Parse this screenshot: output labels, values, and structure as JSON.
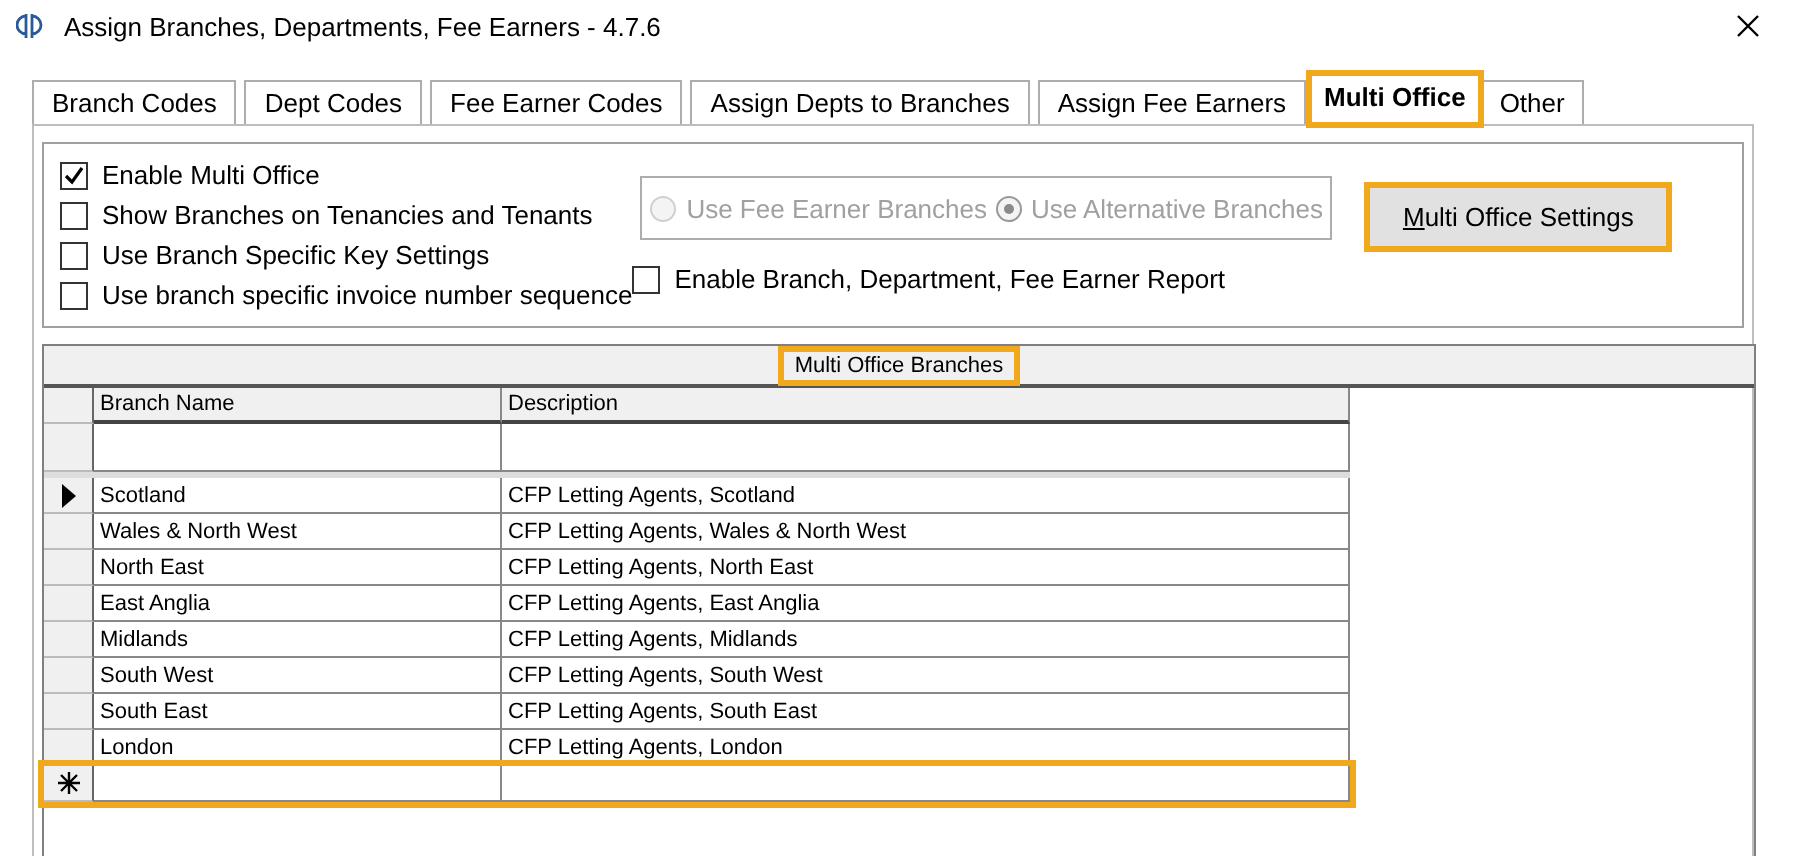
{
  "window": {
    "title": "Assign Branches, Departments, Fee Earners - 4.7.6"
  },
  "tabs": [
    {
      "label": "Branch Codes",
      "selected": false,
      "highlighted": false
    },
    {
      "label": "Dept Codes",
      "selected": false,
      "highlighted": false
    },
    {
      "label": "Fee Earner Codes",
      "selected": false,
      "highlighted": false
    },
    {
      "label": "Assign Depts to Branches",
      "selected": false,
      "highlighted": false
    },
    {
      "label": "Assign Fee Earners",
      "selected": false,
      "highlighted": false
    },
    {
      "label": "Multi Office",
      "selected": true,
      "highlighted": true
    },
    {
      "label": "Other",
      "selected": false,
      "highlighted": false
    }
  ],
  "options": [
    {
      "label": "Enable Multi Office",
      "checked": true
    },
    {
      "label": "Show Branches on Tenancies and Tenants",
      "checked": false
    },
    {
      "label": "Use Branch Specific Key Settings",
      "checked": false
    },
    {
      "label": "Use branch specific invoice number sequence",
      "checked": false
    }
  ],
  "report_option": {
    "label": "Enable Branch, Department, Fee Earner Report",
    "checked": false
  },
  "branch_source": [
    {
      "label": "Use Fee Earner Branches",
      "selected": false,
      "disabled": true
    },
    {
      "label": "Use Alternative Branches",
      "selected": true,
      "disabled": true
    }
  ],
  "settings_button": {
    "mnemonic": "M",
    "label_rest": "ulti Office Settings",
    "highlighted": true
  },
  "grid": {
    "caption": "Multi Office Branches",
    "caption_highlighted": true,
    "columns": [
      "Branch Name",
      "Description"
    ],
    "rows": [
      {
        "cells": [
          "Scotland",
          "CFP Letting Agents, Scotland"
        ],
        "current": true
      },
      {
        "cells": [
          "Wales & North West",
          "CFP Letting Agents, Wales & North West"
        ],
        "current": false
      },
      {
        "cells": [
          "North East",
          "CFP Letting Agents, North East"
        ],
        "current": false
      },
      {
        "cells": [
          "East Anglia",
          "CFP Letting Agents, East Anglia"
        ],
        "current": false
      },
      {
        "cells": [
          "Midlands",
          "CFP Letting Agents, Midlands"
        ],
        "current": false
      },
      {
        "cells": [
          "South West",
          "CFP Letting Agents, South West"
        ],
        "current": false
      },
      {
        "cells": [
          "South East",
          "CFP Letting Agents, South East"
        ],
        "current": false
      },
      {
        "cells": [
          "London",
          "CFP Letting Agents, London"
        ],
        "current": false
      }
    ],
    "new_row_highlighted": true
  }
}
